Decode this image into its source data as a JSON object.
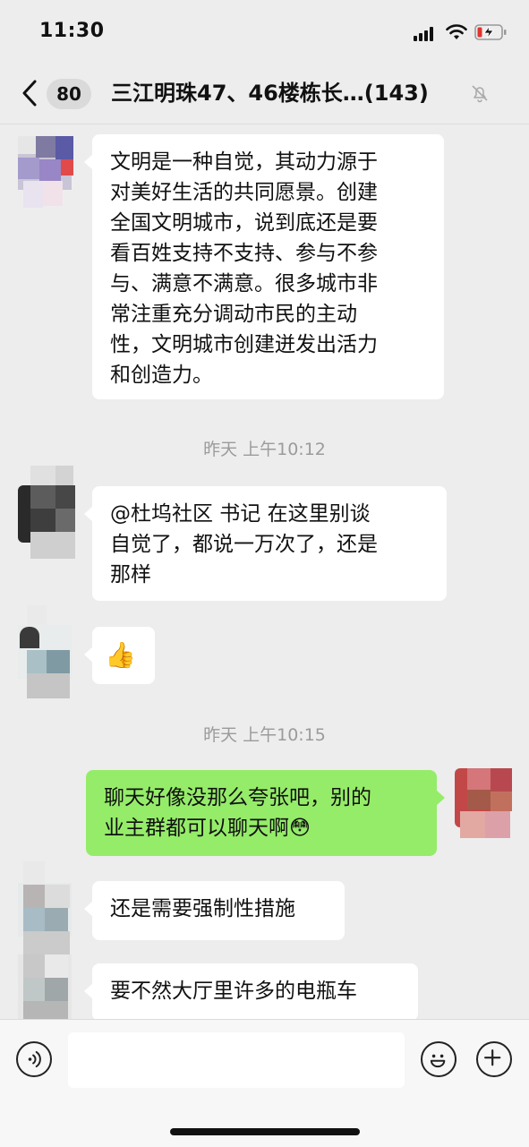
{
  "status": {
    "time": "11:30"
  },
  "nav": {
    "unread_count": "80",
    "title": "三江明珠47、46楼栋长…(143)"
  },
  "messages": [
    {
      "from": "other",
      "lines": [
        "文明是一种自觉，其动力源于",
        "对美好生活的共同愿景。创建",
        "全国文明城市，说到底还是要",
        "看百姓支持不支持、参与不参",
        "与、满意不满意。很多城市非",
        "常注重充分调动市民的主动",
        "性，文明城市创建迸发出活力",
        "和创造力。"
      ]
    },
    {
      "timestamp": "昨天 上午10:12"
    },
    {
      "from": "other",
      "lines": [
        "@杜坞社区 书记 在这里别谈",
        "自觉了，都说一万次了，还是",
        "那样"
      ]
    },
    {
      "from": "other",
      "emoji": "👍"
    },
    {
      "timestamp": "昨天 上午10:15"
    },
    {
      "from": "me",
      "lines": [
        "聊天好像没那么夸张吧，别的",
        "业主群都可以聊天啊😳"
      ]
    },
    {
      "from": "other",
      "lines": [
        "还是需要强制性措施"
      ]
    },
    {
      "from": "other",
      "lines": [
        "要不然大厅里许多的电瓶车"
      ]
    }
  ],
  "icons": {
    "back": "chevron-left-icon",
    "mute": "bell-muted-icon",
    "voice": "voice-icon",
    "emoji": "smiley-icon",
    "more": "plus-icon"
  },
  "colors": {
    "background": "#ededed",
    "my_bubble": "#95ec69",
    "other_bubble": "#ffffff"
  }
}
